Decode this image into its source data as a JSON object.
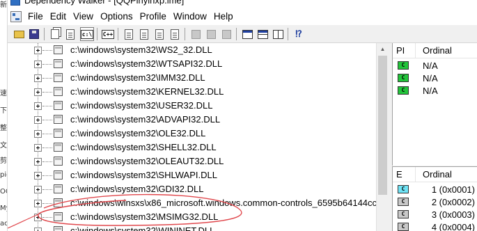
{
  "window": {
    "title": "Dependency Walker - [QQPinyinxp.lme]"
  },
  "background_window": {
    "fragments": [
      "新",
      "速",
      "下载",
      "整理",
      "文件",
      "剪切",
      "pig",
      "OC",
      "My",
      "ac"
    ]
  },
  "menu": {
    "items": [
      "File",
      "Edit",
      "View",
      "Options",
      "Profile",
      "Window",
      "Help"
    ]
  },
  "toolbar": {
    "path_label": "c:\\",
    "cpp_label": "C++",
    "buttons": [
      "open-icon",
      "save-icon",
      "copy-icon",
      "full-paths-button",
      "undecorate-cpp-button",
      "properties-icon",
      "find-icon",
      "highlight-icon",
      "view-full-icon",
      "configure-icon",
      "window-cascade-icon",
      "window-tile-h-icon",
      "window-tile-v-icon",
      "help-icon"
    ]
  },
  "tree": {
    "modules": [
      "c:\\windows\\system32\\WS2_32.DLL",
      "c:\\windows\\system32\\WTSAPI32.DLL",
      "c:\\windows\\system32\\IMM32.DLL",
      "c:\\windows\\system32\\KERNEL32.DLL",
      "c:\\windows\\system32\\USER32.DLL",
      "c:\\windows\\system32\\ADVAPI32.DLL",
      "c:\\windows\\system32\\OLE32.DLL",
      "c:\\windows\\system32\\SHELL32.DLL",
      "c:\\windows\\system32\\OLEAUT32.DLL",
      "c:\\windows\\system32\\SHLWAPI.DLL",
      "c:\\windows\\system32\\GDI32.DLL",
      "c:\\windows\\winsxs\\x86_microsoft.windows.common-controls_6595b64144cc",
      "c:\\windows\\system32\\MSIMG32.DLL",
      "c:\\windows\\system32\\WININET.DLL"
    ]
  },
  "imports_pane": {
    "headers": [
      "PI",
      "Ordinal"
    ],
    "rows": [
      {
        "badge": "C",
        "ordinal": "N/A"
      },
      {
        "badge": "C",
        "ordinal": "N/A"
      },
      {
        "badge": "C",
        "ordinal": "N/A"
      }
    ]
  },
  "exports_pane": {
    "headers": [
      "E",
      "Ordinal"
    ],
    "rows": [
      {
        "badge": "C",
        "ordinal": "1 (0x0001)"
      },
      {
        "badge": "C",
        "ordinal": "2 (0x0002)"
      },
      {
        "badge": "C",
        "ordinal": "3 (0x0003)"
      },
      {
        "badge": "C",
        "ordinal": "4 (0x0004)"
      }
    ]
  },
  "colors": {
    "import_badge": "#22c43a",
    "export_badge_first": "#6fe3f5",
    "export_badge": "#c8c8c8",
    "annotation_circle": "#e0474c"
  }
}
